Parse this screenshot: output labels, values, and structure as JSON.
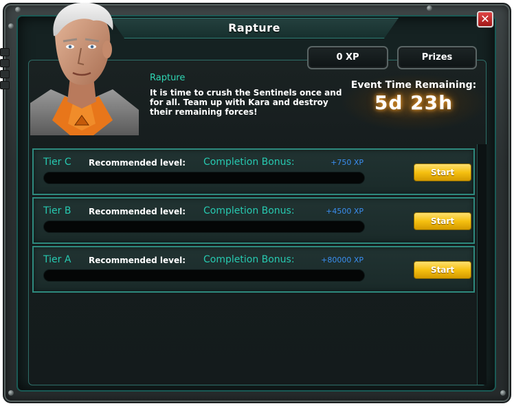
{
  "window": {
    "title": "Rapture",
    "close_glyph": "✕"
  },
  "header": {
    "xp_label": "0 XP",
    "prizes_label": "Prizes"
  },
  "event": {
    "name": "Rapture",
    "description": "It is time to crush the Sentinels once and for all. Team up with Kara and destroy their remaining forces!",
    "time_remaining_label": "Event Time Remaining:",
    "time_remaining_value": "5d 23h"
  },
  "tiers": [
    {
      "name": "Tier C",
      "recommended_label": "Recommended level:",
      "bonus_label": "Completion Bonus:",
      "bonus_value": "+750 XP",
      "progress": 0,
      "start_label": "Start"
    },
    {
      "name": "Tier B",
      "recommended_label": "Recommended level:",
      "bonus_label": "Completion Bonus:",
      "bonus_value": "+4500 XP",
      "progress": 0,
      "start_label": "Start"
    },
    {
      "name": "Tier A",
      "recommended_label": "Recommended level:",
      "bonus_label": "Completion Bonus:",
      "bonus_value": "+80000 XP",
      "progress": 0,
      "start_label": "Start"
    }
  ],
  "colors": {
    "accent_teal": "#27c9b0",
    "bonus_blue": "#3a8ef0",
    "start_gold": "#f5c010",
    "close_red": "#c02020"
  }
}
